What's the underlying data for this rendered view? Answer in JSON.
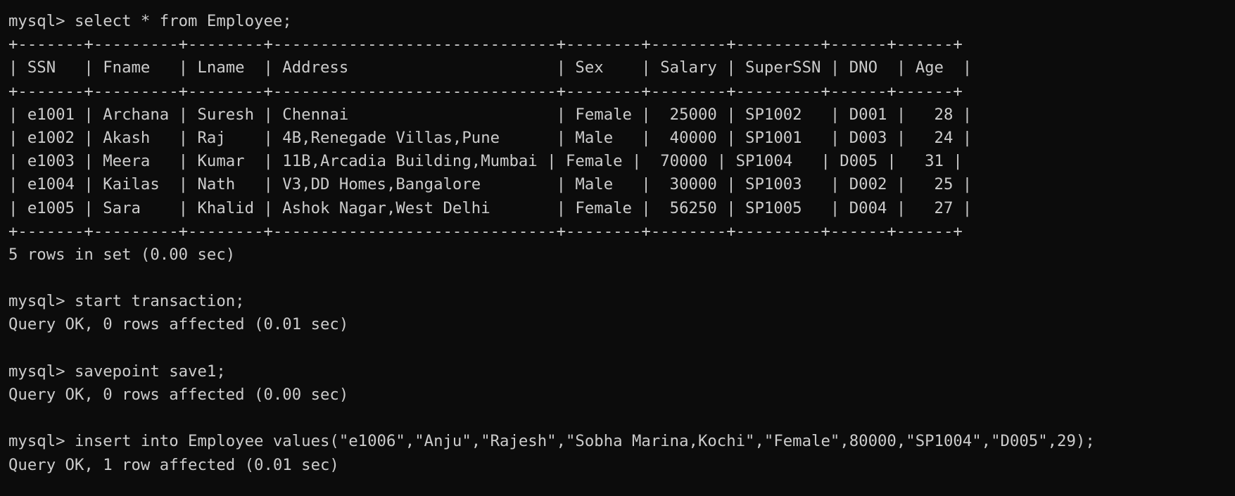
{
  "terminal": {
    "colors": {
      "background": "#0c0c0c",
      "text": "#cccccc"
    },
    "lines": [
      "mysql> select * from Employee;",
      "+-------+---------+--------+------------------------------+--------+--------+---------+------+------+",
      "| SSN   | Fname   | Lname  | Address                      | Sex    | Salary | SuperSSN | DNO  | Age  |",
      "+-------+---------+--------+------------------------------+--------+--------+---------+------+------+",
      "| e1001 | Archana | Suresh | Chennai                      | Female |  25000 | SP1002   | D001 |   28 |",
      "| e1002 | Akash   | Raj    | 4B,Renegade Villas,Pune      | Male   |  40000 | SP1001   | D003 |   24 |",
      "| e1003 | Meera   | Kumar  | 11B,Arcadia Building,Mumbai | Female |  70000 | SP1004   | D005 |   31 |",
      "| e1004 | Kailas  | Nath   | V3,DD Homes,Bangalore        | Male   |  30000 | SP1003   | D002 |   25 |",
      "| e1005 | Sara    | Khalid | Ashok Nagar,West Delhi       | Female |  56250 | SP1005   | D004 |   27 |",
      "+-------+---------+--------+------------------------------+--------+--------+---------+------+------+",
      "5 rows in set (0.00 sec)",
      "",
      "mysql> start transaction;",
      "Query OK, 0 rows affected (0.01 sec)",
      "",
      "mysql> savepoint save1;",
      "Query OK, 0 rows affected (0.00 sec)",
      "",
      "mysql> insert into Employee values(\"e1006\",\"Anju\",\"Rajesh\",\"Sobha Marina,Kochi\",\"Female\",80000,\"SP1004\",\"D005\",29);",
      "Query OK, 1 row affected (0.01 sec)"
    ]
  }
}
